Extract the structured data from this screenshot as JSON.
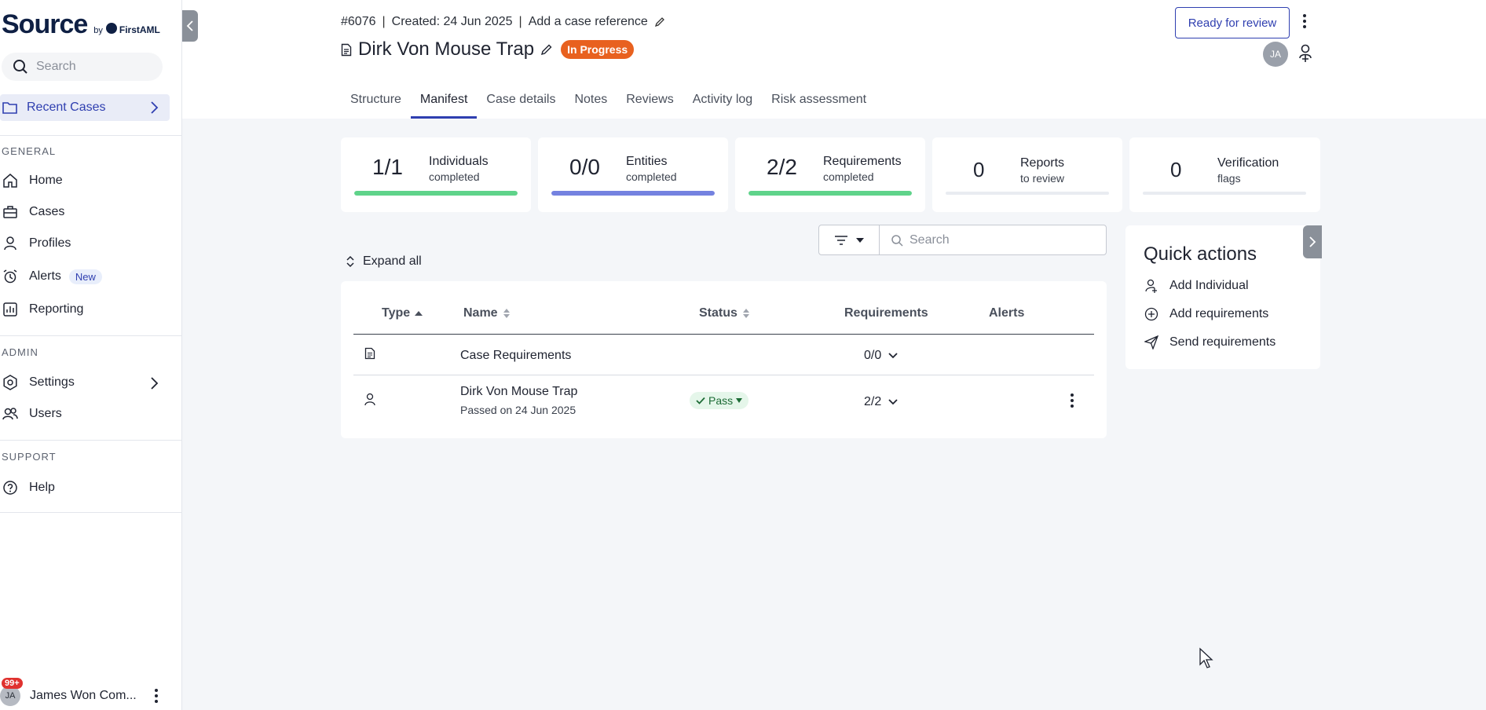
{
  "brand": {
    "word": "Source",
    "by": "by",
    "company": "FirstAML"
  },
  "sidebar": {
    "search_placeholder": "Search",
    "recent_cases": "Recent Cases",
    "sections": {
      "general": "GENERAL",
      "admin": "ADMIN",
      "support": "SUPPORT"
    },
    "general_items": [
      {
        "label": "Home",
        "icon": "home-icon"
      },
      {
        "label": "Cases",
        "icon": "briefcase-icon"
      },
      {
        "label": "Profiles",
        "icon": "person-icon"
      },
      {
        "label": "Alerts",
        "icon": "alarm-icon",
        "badge": "New"
      },
      {
        "label": "Reporting",
        "icon": "chart-icon"
      }
    ],
    "admin_items": [
      {
        "label": "Settings",
        "icon": "gear-icon"
      },
      {
        "label": "Users",
        "icon": "users-icon"
      }
    ],
    "support_items": [
      {
        "label": "Help",
        "icon": "help-icon"
      }
    ],
    "user": {
      "initials": "JA",
      "name": "James Won Com...",
      "notifications": "99+"
    }
  },
  "header": {
    "case_number": "#6076",
    "created": "Created: 24 Jun 2025",
    "add_reference": "Add a case reference",
    "title": "Dirk Von Mouse Trap",
    "status": "In Progress",
    "review_button": "Ready for review",
    "assignee_initials": "JA",
    "tabs": [
      "Structure",
      "Manifest",
      "Case details",
      "Notes",
      "Reviews",
      "Activity log",
      "Risk assessment"
    ],
    "active_tab": "Manifest"
  },
  "stats": [
    {
      "value": "1/1",
      "label": "Individuals",
      "sub": "completed",
      "progress": 1.0,
      "color": "#5fd38a"
    },
    {
      "value": "0/0",
      "label": "Entities",
      "sub": "completed",
      "progress": 1.0,
      "color": "#7482e0"
    },
    {
      "value": "2/2",
      "label": "Requirements",
      "sub": "completed",
      "progress": 1.0,
      "color": "#5fd38a"
    },
    {
      "value": "0",
      "label": "Reports",
      "sub": "to review",
      "progress": 0,
      "color": "#5fd38a"
    },
    {
      "value": "0",
      "label": "Verification",
      "sub": "flags",
      "progress": 0,
      "color": "#5fd38a"
    }
  ],
  "toolbar": {
    "expand_all": "Expand all",
    "search_placeholder": "Search"
  },
  "table": {
    "headers": {
      "type": "Type",
      "name": "Name",
      "status": "Status",
      "requirements": "Requirements",
      "alerts": "Alerts"
    },
    "rows": [
      {
        "type_icon": "document-icon",
        "name": "Case Requirements",
        "sub": "",
        "status": "",
        "requirements": "0/0"
      },
      {
        "type_icon": "person-icon",
        "name": "Dirk Von Mouse Trap",
        "sub": "Passed on 24 Jun 2025",
        "status": "Pass",
        "requirements": "2/2"
      }
    ]
  },
  "quick_actions": {
    "title": "Quick actions",
    "items": [
      {
        "label": "Add Individual",
        "icon": "add-person-icon"
      },
      {
        "label": "Add requirements",
        "icon": "plus-circle-icon"
      },
      {
        "label": "Send requirements",
        "icon": "send-icon"
      }
    ]
  }
}
